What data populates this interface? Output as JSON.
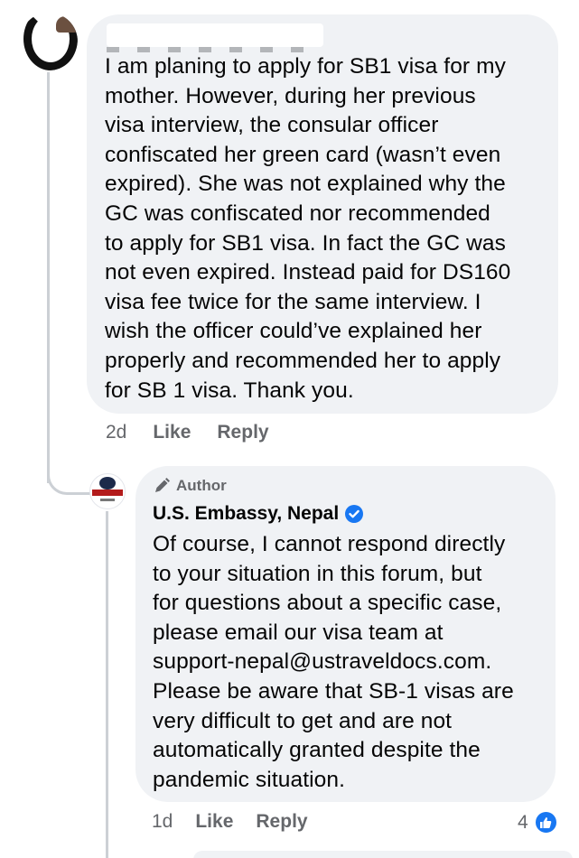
{
  "comment": {
    "body_lines": [
      "I am planing to apply for SB1 visa for my",
      "mother. However, during her previous",
      "visa interview, the consular officer",
      "confiscated her green card (wasn’t even",
      "expired). She was not explained why the",
      "GC was confiscated nor recommended",
      "to apply for SB1 visa. In fact the GC was",
      "not even expired. Instead paid for DS160",
      "visa fee twice for the same interview. I",
      "wish the officer could’ve explained her",
      "properly and recommended her to apply",
      "for SB 1 visa. Thank you."
    ],
    "age": "2d",
    "like_label": "Like",
    "reply_label": "Reply"
  },
  "reply": {
    "author_badge": "Author",
    "page_name": "U.S. Embassy, Nepal",
    "body_lines": [
      "Of course, I cannot respond directly",
      "to your situation in this forum, but",
      "for questions about a specific case,",
      "please email our visa team at",
      "support-nepal@ustraveldocs.com.",
      "Please be aware that SB-1 visas are",
      "very difficult to get and are not",
      "automatically granted despite the",
      "pandemic situation."
    ],
    "age": "1d",
    "like_label": "Like",
    "reply_label": "Reply",
    "reaction_count": "4"
  },
  "colors": {
    "bubble": "#f0f2f5",
    "meta_text": "#65676b",
    "thread_line": "#ccd0d5",
    "facebook_blue": "#1877f2"
  },
  "icons": {
    "author_badge_icon": "pencil-icon",
    "verified_icon": "verified-badge-icon",
    "reaction_icon": "thumbs-up-icon"
  }
}
